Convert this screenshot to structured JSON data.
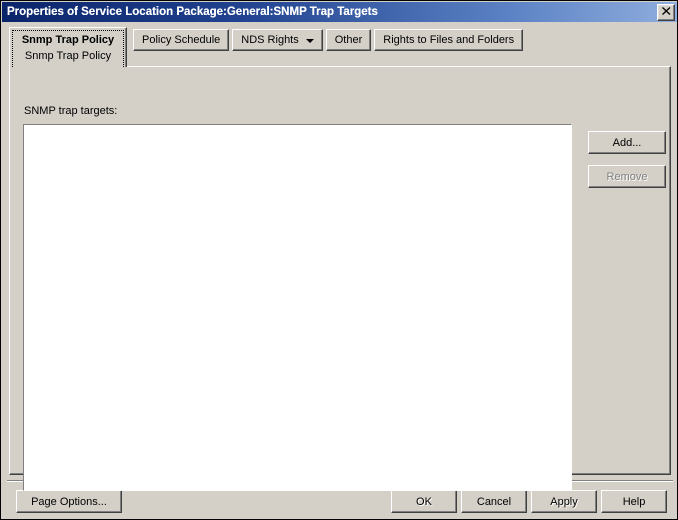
{
  "window": {
    "title": "Properties of Service Location Package:General:SNMP Trap Targets",
    "close_label": "✕",
    "close_icon": "close-icon",
    "titlebar_gradient_start": "#0a246a",
    "titlebar_gradient_end": "#90aede",
    "face_color": "#d4d0c8"
  },
  "tabs": {
    "active": {
      "line1": "Snmp Trap Policy",
      "line2": "Snmp Trap Policy"
    },
    "items": [
      {
        "label": "Policy Schedule",
        "has_dropdown": false
      },
      {
        "label": "NDS Rights",
        "has_dropdown": true,
        "dropdown_icon": "chevron-down-icon"
      },
      {
        "label": "Other",
        "has_dropdown": false
      },
      {
        "label": "Rights to Files and Folders",
        "has_dropdown": false
      }
    ]
  },
  "page": {
    "list_label": "SNMP trap targets:",
    "list_items": [],
    "side_buttons": [
      {
        "label": "Add...",
        "enabled": true
      },
      {
        "label": "Remove",
        "enabled": false
      }
    ]
  },
  "footer": {
    "page_options": {
      "label": "Page Options...",
      "enabled": true
    },
    "ok": {
      "label": "OK",
      "enabled": false
    },
    "cancel": {
      "label": "Cancel",
      "enabled": true
    },
    "apply": {
      "label": "Apply",
      "enabled": false
    },
    "help": {
      "label": "Help",
      "enabled": true
    }
  }
}
